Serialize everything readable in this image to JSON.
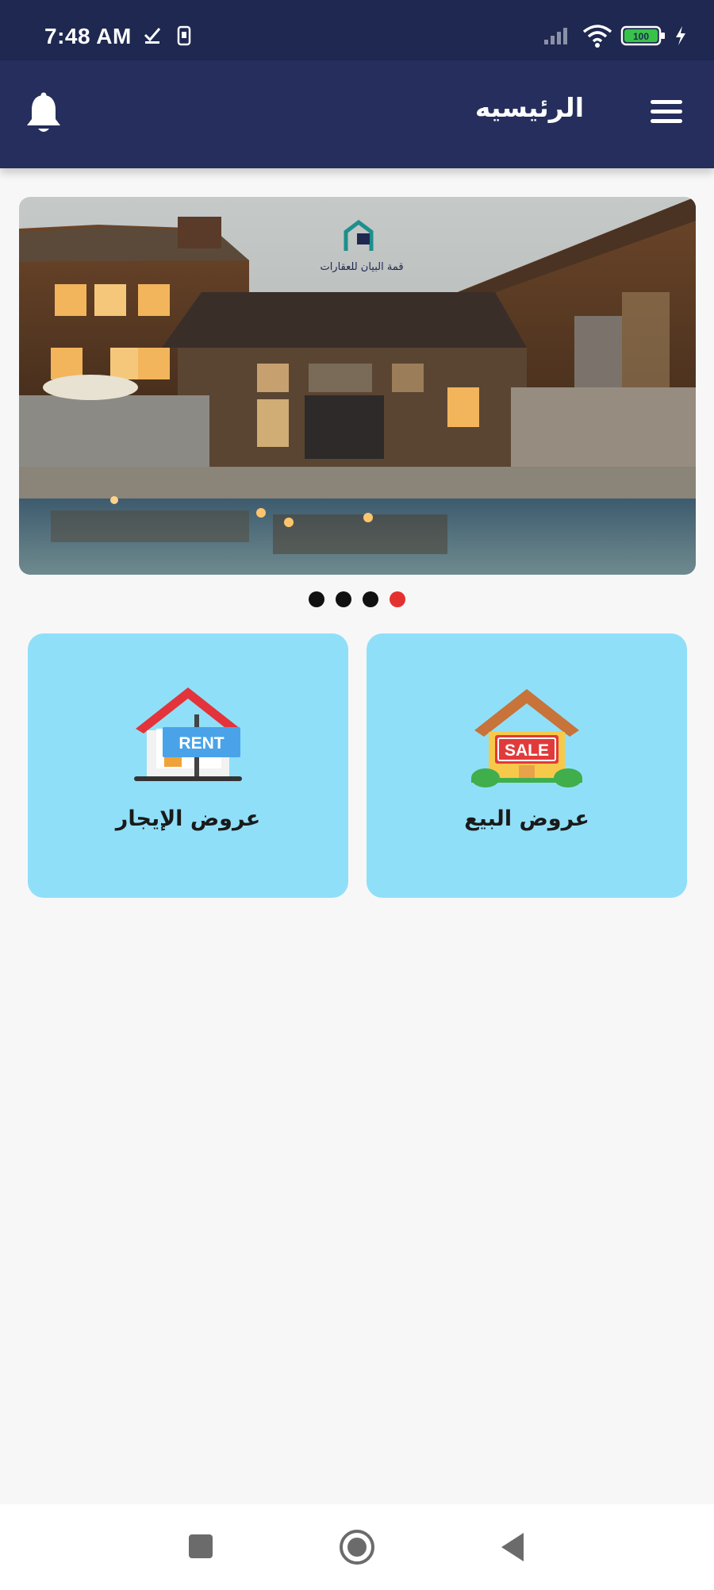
{
  "status_bar": {
    "time": "7:48 AM",
    "battery": "100",
    "icons": [
      "download-done-icon",
      "sim-icon",
      "signal-icon",
      "wifi-icon",
      "battery-icon",
      "charging-icon"
    ]
  },
  "app_bar": {
    "title": "الرئيسيه",
    "menu_icon": "menu-icon",
    "notification_icon": "bell-icon"
  },
  "banner": {
    "logo_text": "قمة البيان للعقارات",
    "slides_count": 4,
    "active_slide": 4
  },
  "cards": [
    {
      "label": "عروض الإيجار",
      "icon": "rent-house-icon",
      "sign": "RENT"
    },
    {
      "label": "عروض البيع",
      "icon": "sale-house-icon",
      "sign": "SALE"
    }
  ],
  "colors": {
    "status_bar": "#1e2850",
    "app_bar": "#252e5c",
    "card_bg": "#90dff8",
    "dot_active": "#e53030",
    "dot_inactive": "#111111"
  },
  "nav_bar": {
    "buttons": [
      "recents-button",
      "home-button",
      "back-button"
    ]
  }
}
